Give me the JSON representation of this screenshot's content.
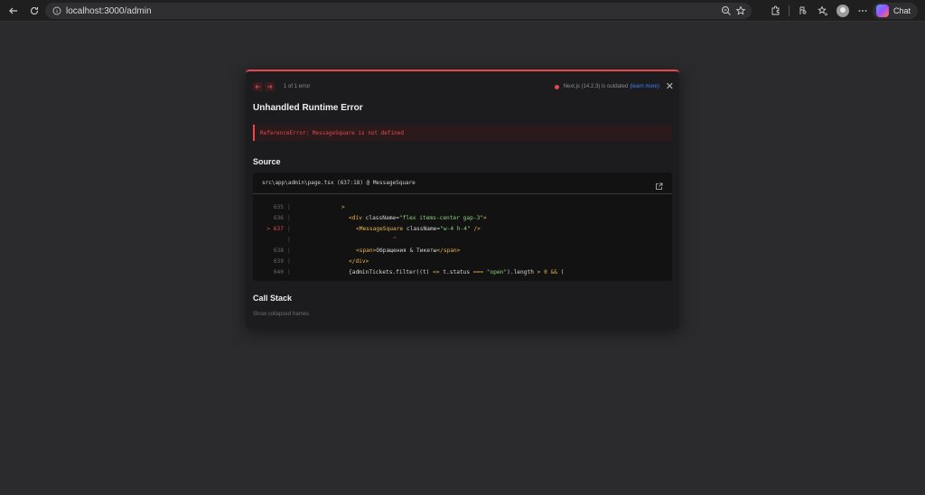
{
  "browser": {
    "url": "localhost:3000/admin",
    "chat_label": "Chat"
  },
  "dialog": {
    "pager_text": "1 of 1 error",
    "version_text": "Next.js (14.2.3) is outdated",
    "learn_more": "(learn more)",
    "title": "Unhandled Runtime Error",
    "error_message": "ReferenceError: MessageSquare is not defined",
    "source_title": "Source",
    "source_path": "src\\app\\admin\\page.tsx (637:18) @ MessageSquare",
    "code_lines": [
      {
        "num": "635",
        "highlight": false
      },
      {
        "num": "636",
        "highlight": false
      },
      {
        "num": "> 637",
        "highlight": true
      },
      {
        "num": "",
        "highlight": false
      },
      {
        "num": "638",
        "highlight": false
      },
      {
        "num": "639",
        "highlight": false
      },
      {
        "num": "640",
        "highlight": false
      }
    ],
    "code": {
      "l635": ">",
      "l636_open": "<div",
      "l636_attr": " className=",
      "l636_str": "\"flex items-center gap-3\"",
      "l636_close": ">",
      "l637_open": "<MessageSquare",
      "l637_attr": " className=",
      "l637_str": "\"w-4 h-4\"",
      "l637_close": " />",
      "caret": "^",
      "l638_open": "<span>",
      "l638_text": "Обращения & Тикеты",
      "l638_close": "</span>",
      "l639": "</div>",
      "l640_a": "{adminTickets.filter((t) ",
      "l640_arrow": "=>",
      "l640_b": " t.status ",
      "l640_eq": "===",
      "l640_str": " \"open\"",
      "l640_c": ").length ",
      "l640_gt": ">",
      "l640_num": " 0",
      "l640_and": " &&",
      "l640_d": " ("
    },
    "stack_title": "Call Stack",
    "collapsed_text": "Show collapsed frames"
  },
  "colors": {
    "accent_error": "#e5484d",
    "link": "#3b82f6"
  }
}
